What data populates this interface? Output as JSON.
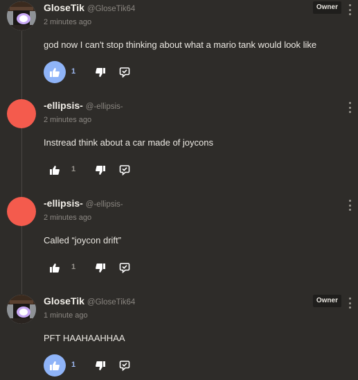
{
  "comments": [
    {
      "author": "GloseTik",
      "handle": "@GloseTik64",
      "time": "2 minutes ago",
      "text": "god now I can't stop thinking about what a mario tank would look like",
      "badge": "Owner",
      "likes": "1",
      "avatar": "knight-avatar",
      "liked": true
    },
    {
      "author": "-ellipsis-",
      "handle": "@-ellipsis-",
      "time": "2 minutes ago",
      "text": "Instread think about a car made of joycons",
      "likes": "1",
      "avatar": "red-circle-avatar",
      "liked": false
    },
    {
      "author": "-ellipsis-",
      "handle": "@-ellipsis-",
      "time": "2 minutes ago",
      "text": "Called “joycon drift”",
      "likes": "1",
      "avatar": "red-circle-avatar",
      "liked": false
    },
    {
      "author": "GloseTik",
      "handle": "@GloseTik64",
      "time": "1 minute ago",
      "text": "PFT HAAHAAHHAA",
      "badge": "Owner",
      "likes": "1",
      "avatar": "knight-avatar",
      "liked": true
    }
  ],
  "colors": {
    "background": "#2e2c29",
    "like_active": "#8fb4f8",
    "avatar_red": "#f45b4d",
    "badge_bg": "#1f1e1c"
  },
  "icons": [
    "thumbs-up-icon",
    "thumbs-down-icon",
    "reply-icon",
    "more-options-icon"
  ]
}
